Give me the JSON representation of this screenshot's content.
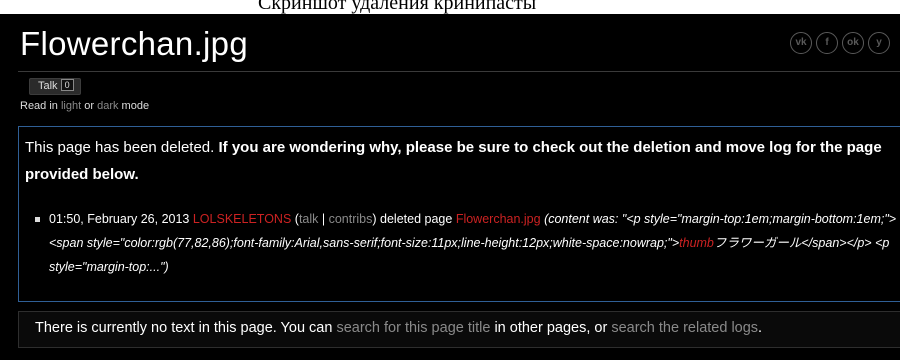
{
  "caption": "Скриншот удаления кринипасты",
  "title": "Flowerchan.jpg",
  "social": [
    {
      "icon": "vk-icon",
      "glyph": "vk"
    },
    {
      "icon": "facebook-icon",
      "glyph": "f"
    },
    {
      "icon": "odnoklassniki-icon",
      "glyph": "ok"
    },
    {
      "icon": "twitter-icon",
      "glyph": "y"
    }
  ],
  "talk": {
    "label": "Talk",
    "count": "0"
  },
  "mode": {
    "prefix": "Read in",
    "light": "light",
    "or": "or",
    "dark": "dark",
    "suffix": "mode"
  },
  "notice": {
    "text_plain": "This page has been deleted.",
    "text_bold": "If you are wondering why, please be sure to check out the deletion and move log for the page provided below."
  },
  "log": {
    "timestamp": "01:50, February 26, 2013",
    "user": "LOLSKELETONS",
    "talk": "talk",
    "sep": "|",
    "contribs": "contribs",
    "action": "deleted page",
    "page": "Flowerchan.jpg",
    "content_prefix": "(content was: \"<p style=\"margin-top:1em;margin-bottom:1em;\"><span style=\"color:rgb(77,82,86);font-family:Arial,sans-serif;font-size:11px;line-height:12px;white-space:nowrap;\">",
    "thumb": "thumb",
    "content_suffix": "フラワーガール</span></p> <p style=\"margin-top:...\")"
  },
  "no_text": {
    "before": "There is currently no text in this page. You can",
    "link1": "search for this page title",
    "middle": "in other pages, or",
    "link2": "search the related logs",
    "end": "."
  },
  "colors": {
    "background": "#000000",
    "link_red": "#cc2222",
    "link_grey": "#8a8a8a",
    "notice_border": "#2f5f96"
  }
}
